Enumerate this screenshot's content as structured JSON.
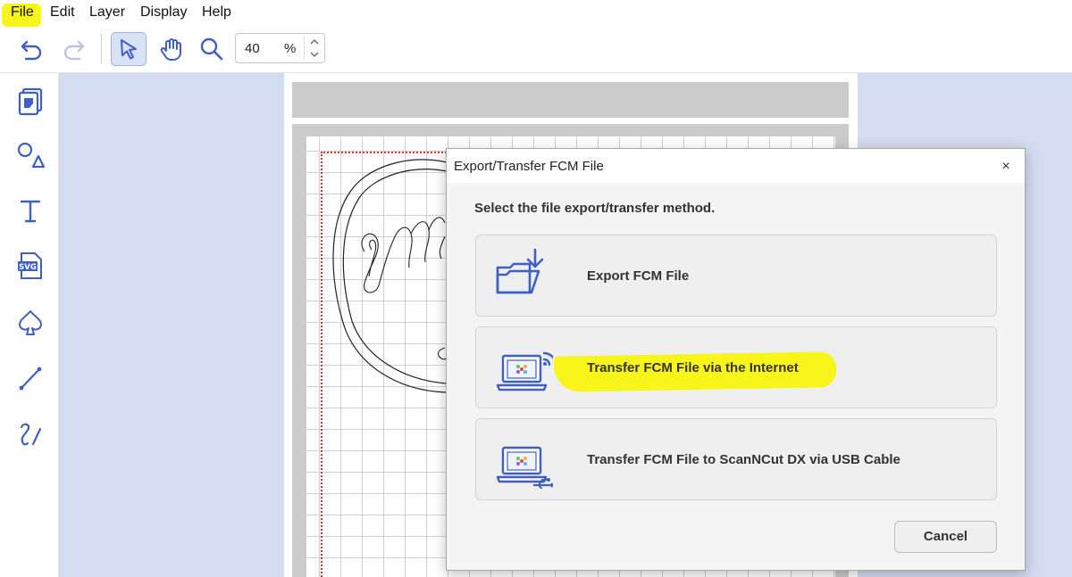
{
  "menu": {
    "file": "File",
    "edit": "Edit",
    "layer": "Layer",
    "display": "Display",
    "help": "Help"
  },
  "toolbar": {
    "zoom_value": "40",
    "zoom_unit": "%"
  },
  "dialog": {
    "title": "Export/Transfer FCM File",
    "close": "×",
    "subtitle": "Select the file export/transfer method.",
    "options": [
      {
        "label": "Export FCM File",
        "icon": "folder-download-icon"
      },
      {
        "label": "Transfer FCM File via the Internet",
        "icon": "laptop-wireless-icon"
      },
      {
        "label": "Transfer FCM File to ScanNCut DX via USB Cable",
        "icon": "laptop-usb-icon"
      }
    ],
    "cancel": "Cancel"
  },
  "colors": {
    "accent": "#4a67c9",
    "highlight": "#f8f51a",
    "workspace": "#d3dcf0"
  }
}
